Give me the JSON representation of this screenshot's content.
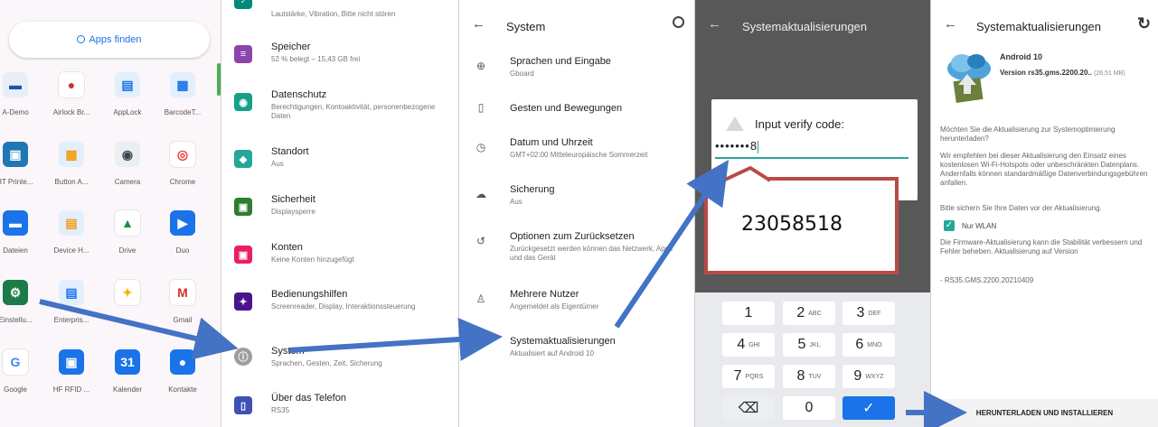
{
  "drawer": {
    "search_label": "Apps finden",
    "apps": [
      {
        "label": "A-Demo",
        "color": "#e8eef8",
        "glyph": "▬",
        "fg": "#1a56a8"
      },
      {
        "label": "Airlock Br...",
        "color": "#ffffff",
        "glyph": "●",
        "fg": "#c0392b"
      },
      {
        "label": "AppLock",
        "color": "#e3effc",
        "glyph": "▤",
        "fg": "#1a73e8"
      },
      {
        "label": "BarcodeT...",
        "color": "#e3effc",
        "glyph": "▦",
        "fg": "#1a73e8"
      },
      {
        "label": "3T Printe...",
        "color": "#1f77b4",
        "glyph": "▣",
        "fg": "#ffffff"
      },
      {
        "label": "Button A...",
        "color": "#e3effc",
        "glyph": "▦",
        "fg": "#f39c12"
      },
      {
        "label": "Camera",
        "color": "#eceff1",
        "glyph": "◉",
        "fg": "#37474f"
      },
      {
        "label": "Chrome",
        "color": "#ffffff",
        "glyph": "◎",
        "fg": "#e53935"
      },
      {
        "label": "Dateien",
        "color": "#1a73e8",
        "glyph": "▬",
        "fg": "#ffffff"
      },
      {
        "label": "Device H...",
        "color": "#e3effc",
        "glyph": "▤",
        "fg": "#f39c12"
      },
      {
        "label": "Drive",
        "color": "#ffffff",
        "glyph": "▲",
        "fg": "#1e8e3e"
      },
      {
        "label": "Duo",
        "color": "#1a73e8",
        "glyph": "▶",
        "fg": "#ffffff"
      },
      {
        "label": "Einstellu...",
        "color": "#1e7a46",
        "glyph": "⚙",
        "fg": "#ffffff"
      },
      {
        "label": "Enterpris...",
        "color": "#e3effc",
        "glyph": "▤",
        "fg": "#1a73e8"
      },
      {
        "label": "",
        "color": "#ffffff",
        "glyph": "✦",
        "fg": "#f4b400"
      },
      {
        "label": "Gmail",
        "color": "#ffffff",
        "glyph": "M",
        "fg": "#d93025"
      },
      {
        "label": "Google",
        "color": "#ffffff",
        "glyph": "G",
        "fg": "#4285f4"
      },
      {
        "label": "HF RFID ...",
        "color": "#1a73e8",
        "glyph": "▣",
        "fg": "#ffffff"
      },
      {
        "label": "Kalender",
        "color": "#1a73e8",
        "glyph": "31",
        "fg": "#ffffff"
      },
      {
        "label": "Kontakte",
        "color": "#1a73e8",
        "glyph": "●",
        "fg": "#ffffff"
      }
    ]
  },
  "settings": {
    "top_partial": "Lautstärke, Vibration, Bitte nicht stören",
    "items": [
      {
        "title": "Speicher",
        "sub": "52 % belegt – 15,43 GB frei",
        "color": "#8e44ad",
        "glyph": "≡"
      },
      {
        "title": "Datenschutz",
        "sub": "Berechtigungen, Kontoaktivität, personenbezogene Daten",
        "color": "#16a085",
        "glyph": "◉"
      },
      {
        "title": "Standort",
        "sub": "Aus",
        "color": "#26a69a",
        "glyph": "◆"
      },
      {
        "title": "Sicherheit",
        "sub": "Displaysperre",
        "color": "#2e7d32",
        "glyph": "▣"
      },
      {
        "title": "Konten",
        "sub": "Keine Konten hinzugefügt",
        "color": "#e91e63",
        "glyph": "▣"
      },
      {
        "title": "Bedienungshilfen",
        "sub": "Screenreader, Display, Interaktionssteuerung",
        "color": "#4a148c",
        "glyph": "✦"
      },
      {
        "title": "System",
        "sub": "Sprachen, Gesten, Zeit, Sicherung",
        "color": "#9e9e9e",
        "glyph": "ⓘ"
      },
      {
        "title": "Über das Telefon",
        "sub": "RS35",
        "color": "#3f51b5",
        "glyph": "▯"
      }
    ]
  },
  "system": {
    "back_icon": "←",
    "title": "System",
    "items": [
      {
        "title": "Sprachen und Eingabe",
        "sub": "Gboard",
        "icon": "⊕"
      },
      {
        "title": "Gesten und Bewegungen",
        "sub": "",
        "icon": "▯"
      },
      {
        "title": "Datum und Uhrzeit",
        "sub": "GMT+02:00 Mitteleuropäische Sommerzeit",
        "icon": "◷"
      },
      {
        "title": "Sicherung",
        "sub": "Aus",
        "icon": "☁"
      },
      {
        "title": "Optionen zum Zurücksetzen",
        "sub": "Zurückgesetzt werden können das Netzwerk, Apps und das Gerät",
        "icon": "↺"
      },
      {
        "title": "Mehrere Nutzer",
        "sub": "Angemeldet als Eigentümer",
        "icon": "♙"
      },
      {
        "title": "Systemaktualisierungen",
        "sub": "Aktualisiert auf Android 10",
        "icon": ""
      }
    ]
  },
  "verify": {
    "back_icon": "←",
    "title": "Systemaktualisierungen",
    "dialog_title": "Input verify code:",
    "input_value": "•••••••8",
    "callout_code": "23058518",
    "keys": [
      {
        "num": "1",
        "letters": ""
      },
      {
        "num": "2",
        "letters": "ABC"
      },
      {
        "num": "3",
        "letters": "DEF"
      },
      {
        "num": "4",
        "letters": "GHI"
      },
      {
        "num": "5",
        "letters": "JKL"
      },
      {
        "num": "6",
        "letters": "MNO"
      },
      {
        "num": "7",
        "letters": "PQRS"
      },
      {
        "num": "8",
        "letters": "TUV"
      },
      {
        "num": "9",
        "letters": "WXYZ"
      },
      {
        "num": "⌫",
        "letters": ""
      },
      {
        "num": "0",
        "letters": ""
      },
      {
        "num": "✓",
        "letters": ""
      }
    ]
  },
  "update": {
    "back_icon": "←",
    "title": "Systemaktualisierungen",
    "refresh_icon": "↻",
    "android_label": "Android 10",
    "version_label": "Version rs35.gms.2200.20..",
    "size_label": "(26,51 MB)",
    "question": "Möchten Sie die Aktualisierung zur Systemoptimierung herunterladen?",
    "recommend": "Wir empfehlen bei dieser Aktualisierung den Einsatz eines kostenlosen Wi-Fi-Hotspots oder unbeschränkten Datenplans. Andernfalls können standardmäßige Datenverbindungsgebühren anfallen.",
    "backup_note": "Bitte sichern Sie Ihre Daten vor der Aktualisierung.",
    "wlan_label": "Nur WLAN",
    "firmware_note": "Die Firmware-Aktualisierung kann die Stabilität verbessern und Fehler beheben. Aktualisierung auf Version",
    "version_line": "- RS35.GMS.2200.20210409",
    "install_button": "HERUNTERLADEN UND INSTALLIEREN"
  },
  "colors": {
    "arrow": "#4472c4",
    "callout_border": "#b94a48",
    "accent": "#1a73e8"
  }
}
